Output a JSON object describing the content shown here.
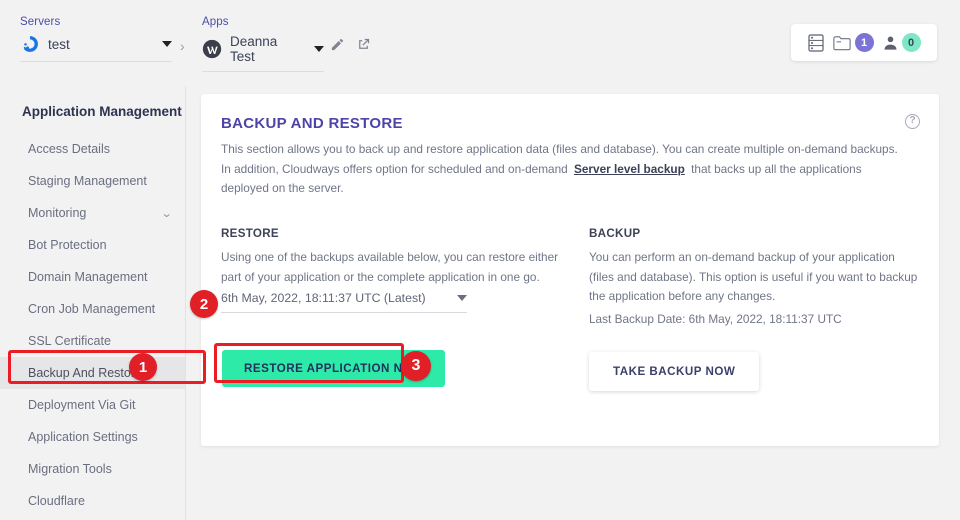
{
  "topbar": {
    "servers": {
      "label": "Servers",
      "name": "test",
      "icon": "cloudways-logo-icon",
      "caret": "dropdown-caret-icon"
    },
    "separator": "›",
    "apps": {
      "label": "Apps",
      "name": "Deanna Test",
      "icon": "wordpress-logo-icon",
      "caret": "dropdown-caret-icon"
    },
    "actions": {
      "edit": "pencil-icon",
      "open": "external-link-icon"
    },
    "right_pill": {
      "server_list_icon": "server-list-icon",
      "projects": {
        "icon": "folder-icon",
        "count": "1"
      },
      "team": {
        "icon": "user-icon",
        "count": "0"
      }
    }
  },
  "sidebar": {
    "title": "Application Management",
    "items": [
      {
        "label": "Access Details",
        "active": false,
        "expandable": false
      },
      {
        "label": "Staging Management",
        "active": false,
        "expandable": false
      },
      {
        "label": "Monitoring",
        "active": false,
        "expandable": true
      },
      {
        "label": "Bot Protection",
        "active": false,
        "expandable": false
      },
      {
        "label": "Domain Management",
        "active": false,
        "expandable": false
      },
      {
        "label": "Cron Job Management",
        "active": false,
        "expandable": false
      },
      {
        "label": "SSL Certificate",
        "active": false,
        "expandable": false
      },
      {
        "label": "Backup And Restore",
        "active": true,
        "expandable": false
      },
      {
        "label": "Deployment Via Git",
        "active": false,
        "expandable": false
      },
      {
        "label": "Application Settings",
        "active": false,
        "expandable": false
      },
      {
        "label": "Migration Tools",
        "active": false,
        "expandable": false
      },
      {
        "label": "Cloudflare",
        "active": false,
        "expandable": false
      }
    ]
  },
  "card": {
    "title": "BACKUP AND RESTORE",
    "help_icon": "help-icon",
    "description_part1": "This section allows you to back up and restore application data (files and database). You can create multiple on-demand backups. In addition, Cloudways offers option for scheduled and on-demand",
    "description_link": "Server level backup",
    "description_part2": "that backs up all the applications deployed on the server.",
    "restore": {
      "heading": "RESTORE",
      "body": "Using one of the backups available below, you can restore either part of your application or the complete application in one go.",
      "select_value": "6th May, 2022, 18:11:37 UTC (Latest)",
      "button_label": "RESTORE APPLICATION NOW"
    },
    "backup": {
      "heading": "BACKUP",
      "body": "You can perform an on-demand backup of your application (files and database). This option is useful if you want to backup the application before any changes.",
      "last_backup": "Last Backup Date: 6th May, 2022, 18:11:37 UTC",
      "button_label": "TAKE BACKUP NOW"
    }
  },
  "annotations": {
    "step1": "1",
    "step2": "2",
    "step3": "3",
    "highlight_color": "#ec1c24",
    "badge_color": "#e01f26"
  },
  "colors": {
    "accent_purple": "#4e44a8",
    "green_button": "#2eeaa8",
    "page_bg": "#f2f2f3"
  }
}
